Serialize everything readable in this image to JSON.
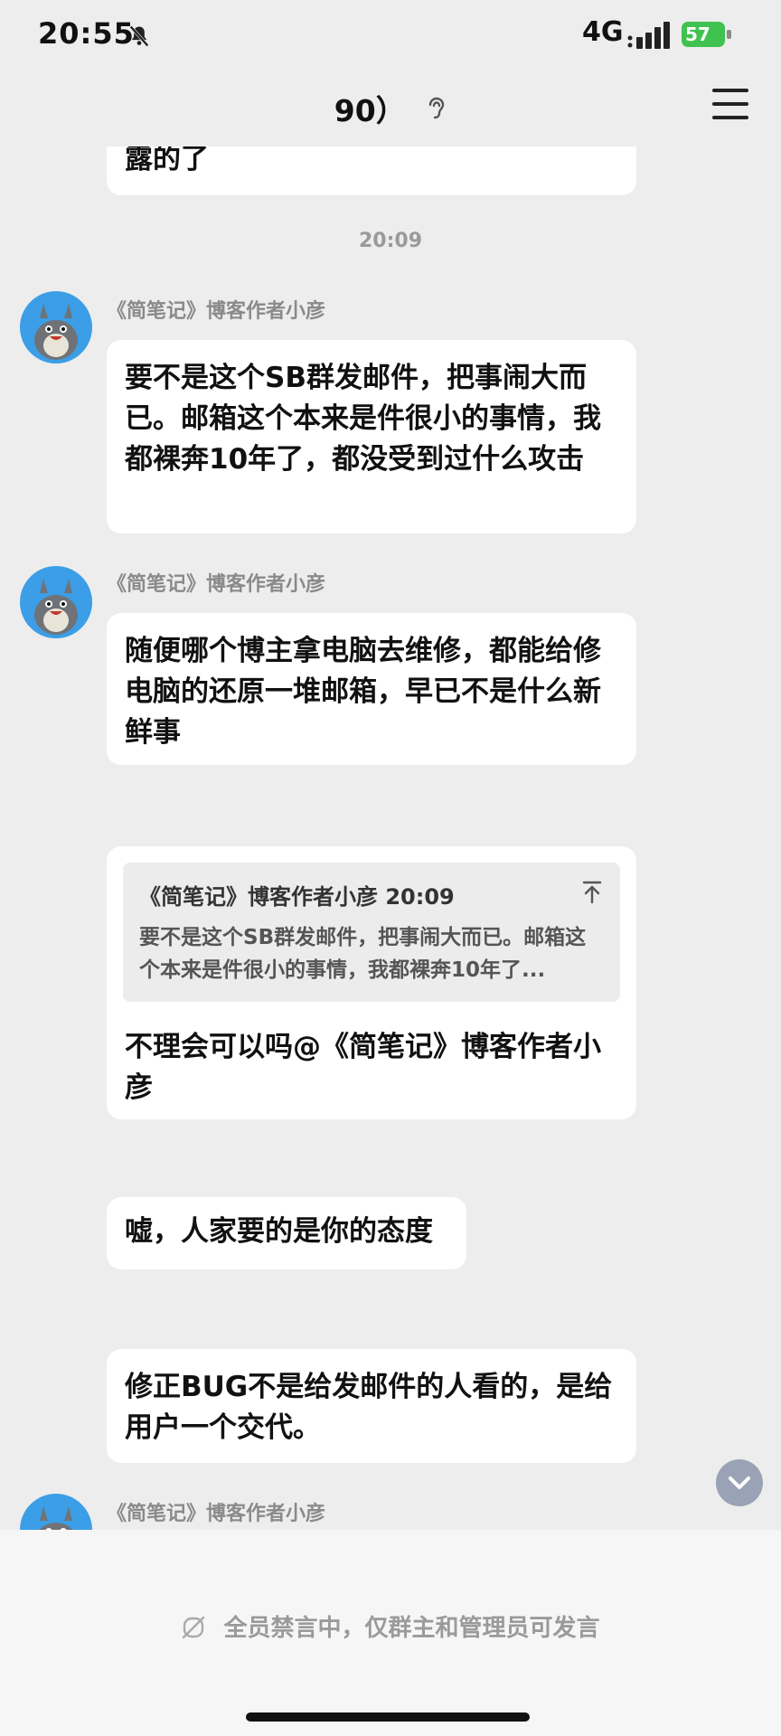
{
  "status_bar": {
    "time": "20:55",
    "network": "4G",
    "battery": "57"
  },
  "nav": {
    "title": "90）"
  },
  "messages": {
    "partial_top": "露的了",
    "timestamp": "20:09",
    "sender_name": "《简笔记》博客作者小彦",
    "msg1": "要不是这个SB群发邮件，把事闹大而已。邮箱这个本来是件很小的事情，我都裸奔10年了，都没受到过什么攻击",
    "msg2": "随便哪个博主拿电脑去维修，都能给修电脑的还原一堆邮箱，早已不是什么新鲜事",
    "quote_header": "《简笔记》博客作者小彦 20:09",
    "quote_body": "要不是这个SB群发邮件，把事闹大而已。邮箱这个本来是件很小的事情，我都裸奔10年了...",
    "reply": "不理会可以吗@《简笔记》博客作者小彦",
    "msg3": "嘘，人家要的是你的态度",
    "msg4": "修正BUG不是给发邮件的人看的，是给用户一个交代。"
  },
  "bottom": {
    "muted_notice": "全员禁言中，仅群主和管理员可发言"
  }
}
